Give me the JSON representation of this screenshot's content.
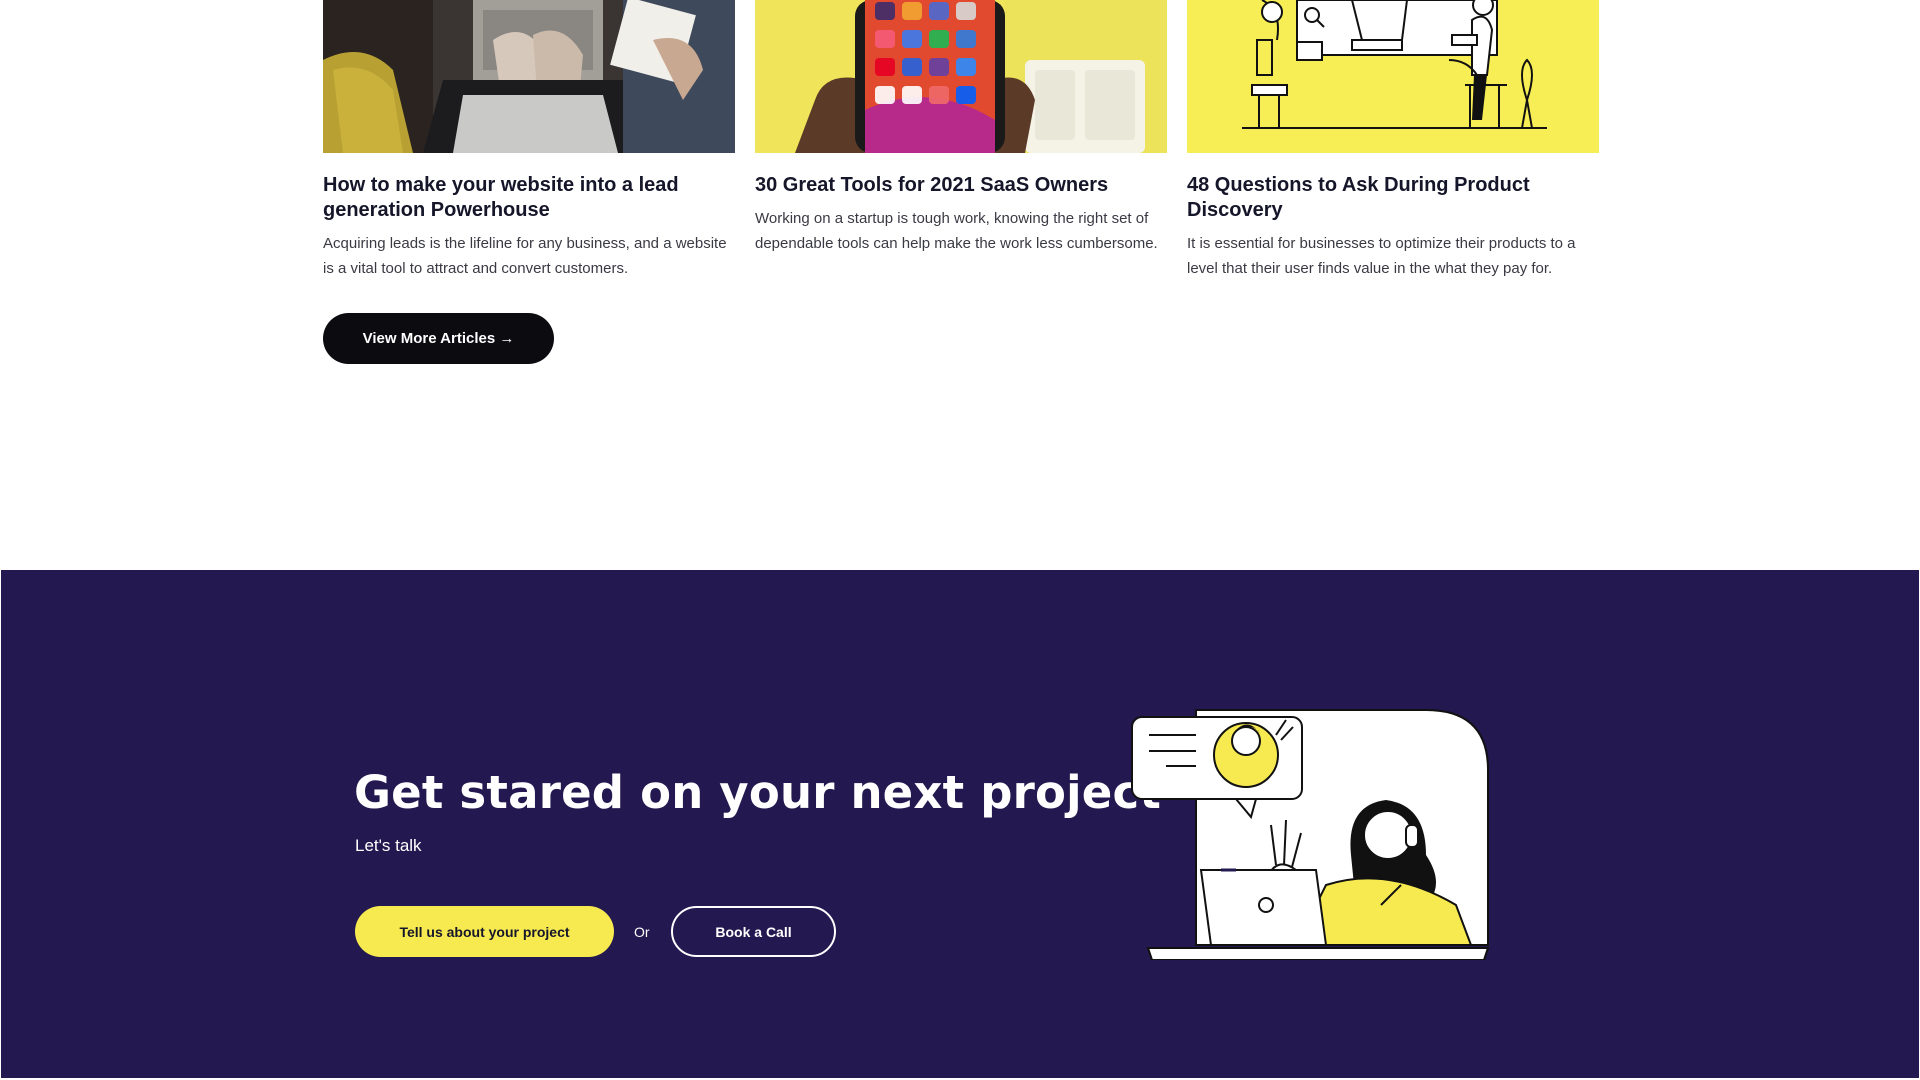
{
  "articles": [
    {
      "title": "How to make your website into a lead generation Powerhouse",
      "description": "Acquiring leads is the lifeline for any business, and a website is a vital tool to attract and convert customers.",
      "image_icon": "laptop-photo"
    },
    {
      "title": "30 Great Tools for 2021 SaaS Owners",
      "description": "Working on a startup is tough work, knowing the right set of dependable tools can help make the work less cumbersome.",
      "image_icon": "smartphone-apps-photo"
    },
    {
      "title": "48 Questions to Ask During Product Discovery",
      "description": "It is essential for businesses to optimize their products to a level that their user finds value in the what they pay for.",
      "image_icon": "team-illustration"
    }
  ],
  "view_more_label": "View More Articles →",
  "cta": {
    "title": "Get stared on your next project",
    "subtitle": "Let's talk",
    "primary_label": "Tell us about your project",
    "or_label": "Or",
    "secondary_label": "Book a Call",
    "illustration_icon": "video-call-illustration"
  },
  "colors": {
    "accent_yellow": "#f7ea50",
    "cta_background": "#23184f",
    "button_dark": "#0b0b10"
  }
}
